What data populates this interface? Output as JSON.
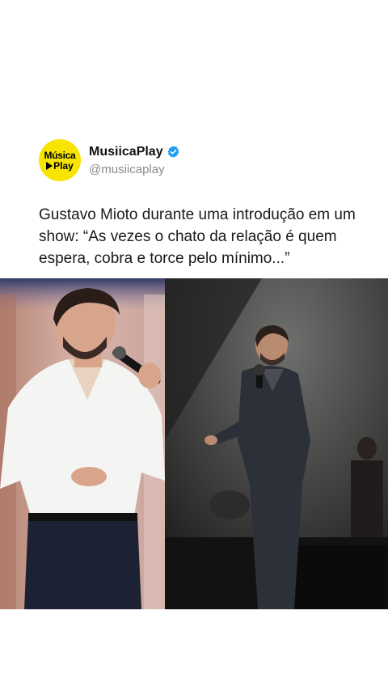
{
  "account": {
    "avatar_line1": "Música",
    "avatar_line2": "Play",
    "display_name": "MusiicaPlay",
    "handle": "@musiicaplay",
    "verified": true,
    "avatar_color": "#f7e400",
    "verified_color": "#1d9bf0"
  },
  "post": {
    "text": "Gustavo Mioto durante uma introdução em um show: “As vezes o chato da relação é quem espera, cobra e torce pelo mínimo...”"
  },
  "media": {
    "left_icon": "photo-singer-white-shirt",
    "right_icon": "photo-singer-on-stage"
  }
}
